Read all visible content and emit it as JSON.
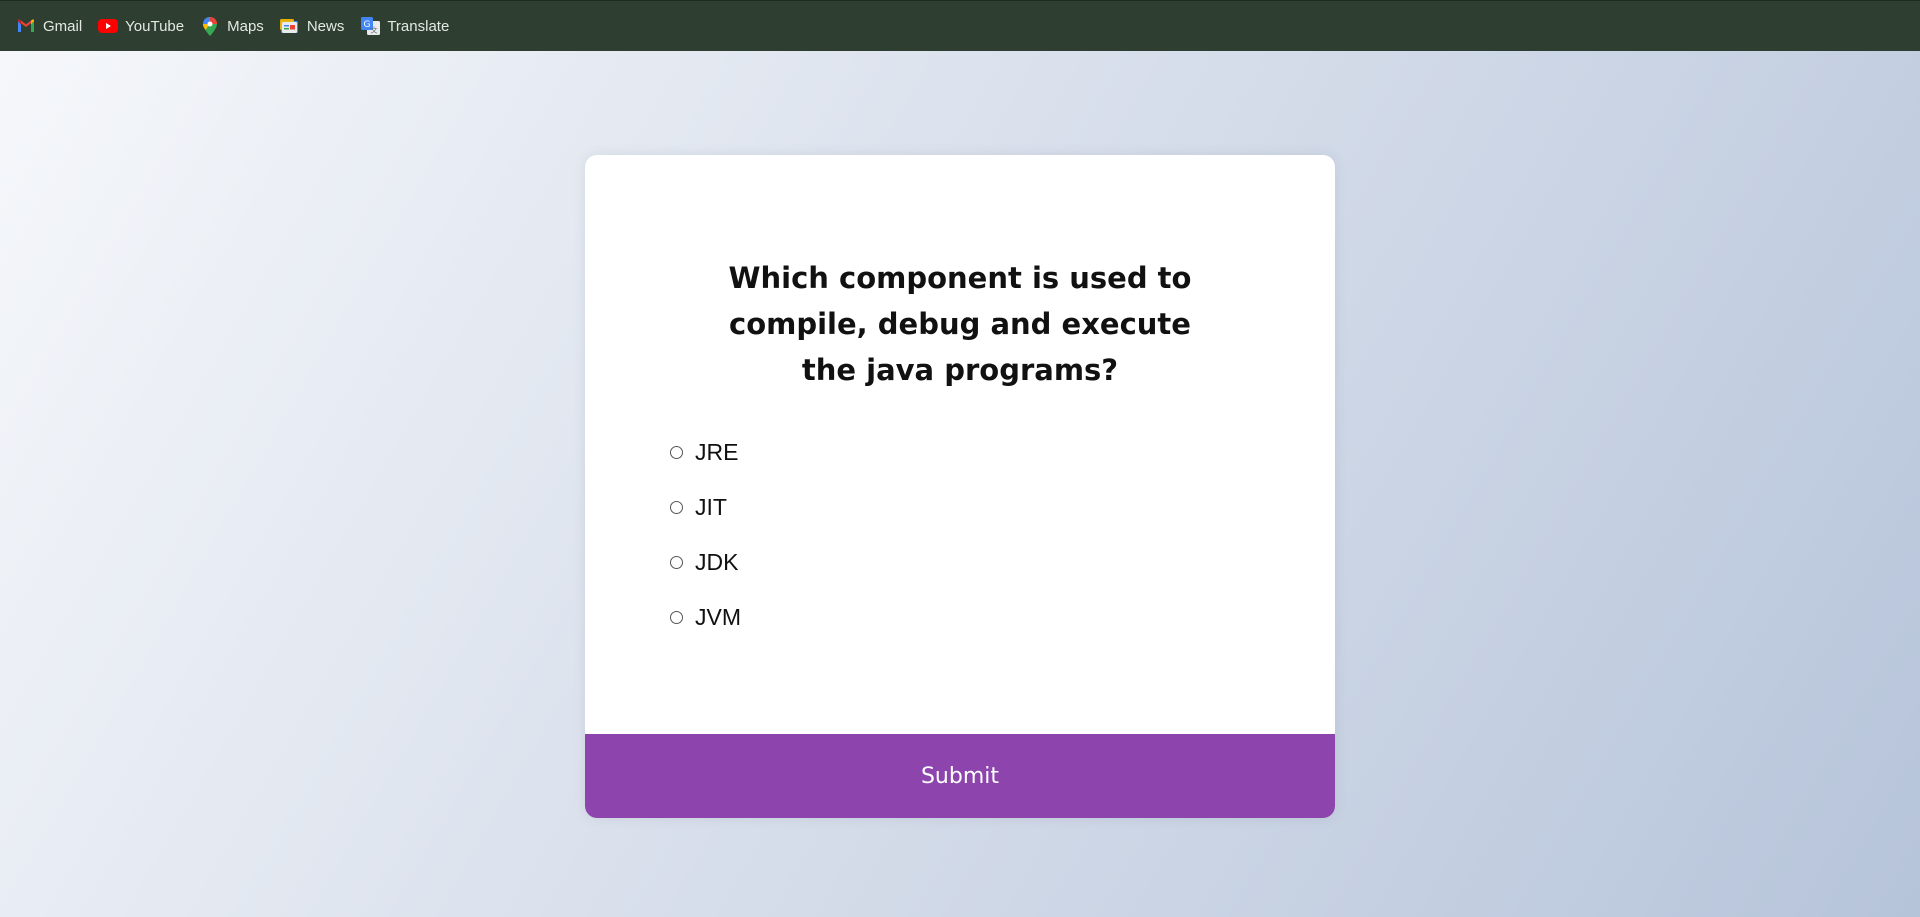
{
  "bookmarks": [
    {
      "label": "Gmail",
      "icon": "gmail-icon"
    },
    {
      "label": "YouTube",
      "icon": "youtube-icon"
    },
    {
      "label": "Maps",
      "icon": "maps-icon"
    },
    {
      "label": "News",
      "icon": "news-icon"
    },
    {
      "label": "Translate",
      "icon": "translate-icon"
    }
  ],
  "quiz": {
    "question": "Which component is used to compile, debug and execute the java programs?",
    "answers": [
      {
        "label": "JRE",
        "selected": false
      },
      {
        "label": "JIT",
        "selected": false
      },
      {
        "label": "JDK",
        "selected": false
      },
      {
        "label": "JVM",
        "selected": false
      }
    ],
    "submit_label": "Submit"
  },
  "colors": {
    "bookmarks_bar": "#2e3e30",
    "submit_button": "#8e44ad",
    "card": "#ffffff"
  }
}
